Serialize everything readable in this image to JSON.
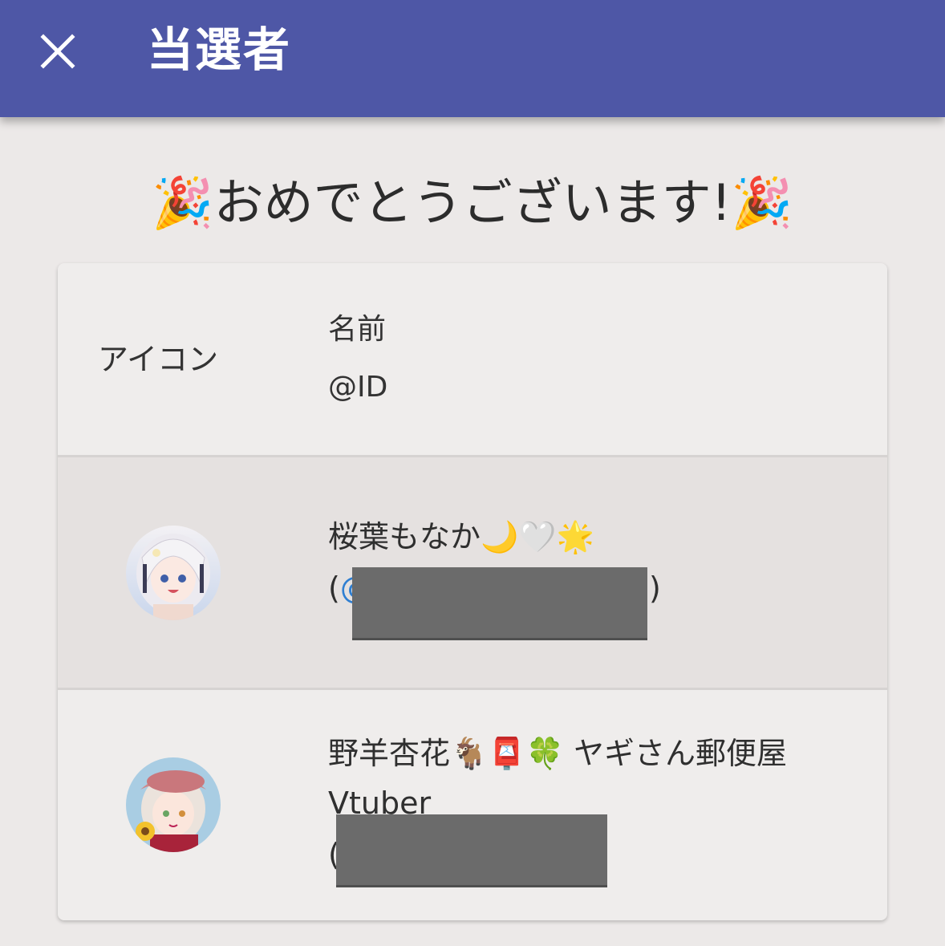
{
  "appbar": {
    "title": "当選者",
    "close_icon": "close-icon",
    "bg_color": "#4e57a6"
  },
  "banner": {
    "text": "🎉おめでとうございます!🎉"
  },
  "table": {
    "header": {
      "icon_label": "アイコン",
      "name_label": "名前",
      "id_label": "@ID"
    },
    "rows": [
      {
        "name": "桜葉もなか🌙🤍🌟",
        "id_prefix": "(",
        "id_at": "@",
        "id_suffix": ")",
        "id_redacted": true
      },
      {
        "name": "野羊杏花🐐📮🍀 ヤギさん郵便屋",
        "name_line2": "Vtuber",
        "id_prefix": "(",
        "id_redacted": true
      }
    ]
  }
}
